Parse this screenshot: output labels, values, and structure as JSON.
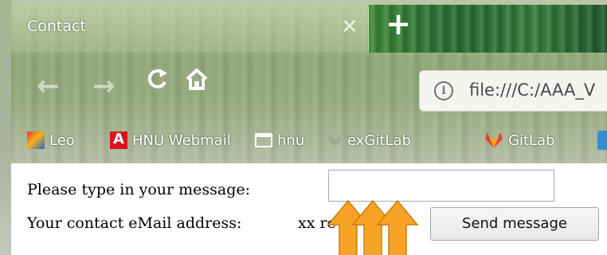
{
  "browser": {
    "tab_title": "Contact",
    "tab_close": "✕",
    "new_tab": "+",
    "nav": {
      "back": "←",
      "forward": "→",
      "reload": "C",
      "home": "⌂"
    },
    "url_info": "i",
    "url": "file:///C:/AAA_V"
  },
  "bookmarks": [
    {
      "label": "Leo",
      "icon": "leo-icon"
    },
    {
      "label": "HNU Webmail",
      "icon": "hnu-icon"
    },
    {
      "label": "hnu",
      "icon": "folder-icon"
    },
    {
      "label": "exGitLab",
      "icon": "exgitlab-icon"
    },
    {
      "label": "GitLab",
      "icon": "gitlab-icon"
    }
  ],
  "page": {
    "message_label": "Please type in your message:",
    "message_value": "",
    "email_label": "Your contact eMail address:",
    "email_value_visible": "xx        re",
    "send_button": "Send message"
  },
  "colors": {
    "arrow_fill": "#f7a325",
    "arrow_stroke": "#d07a10"
  }
}
